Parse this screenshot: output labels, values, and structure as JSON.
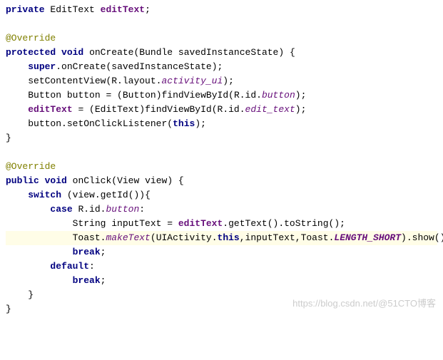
{
  "code": {
    "l1_private": "private",
    "l1_type": "EditText",
    "l1_var": "editText",
    "l3_anno": "@Override",
    "l4_protected": "protected",
    "l4_void": "void",
    "l4_fn": "onCreate",
    "l4_ptype": "Bundle",
    "l4_pname": "savedInstanceState",
    "l5_super": "super",
    "l5_call": "onCreate",
    "l5_arg": "savedInstanceState",
    "l6_call": "setContentView",
    "l6_r": "R.layout.",
    "l6_res": "activity_ui",
    "l7_type": "Button",
    "l7_name": "button",
    "l7_cast": "Button",
    "l7_call": "findViewById",
    "l7_r": "R.id.",
    "l7_res": "button",
    "l8_var": "editText",
    "l8_cast": "EditText",
    "l8_call": "findViewById",
    "l8_r": "R.id.",
    "l8_res": "edit_text",
    "l9_obj": "button",
    "l9_call": "setOnClickListener",
    "l9_this": "this",
    "l12_anno": "@Override",
    "l13_public": "public",
    "l13_void": "void",
    "l13_fn": "onClick",
    "l13_ptype": "View",
    "l13_pname": "view",
    "l14_switch": "switch",
    "l14_expr1": "view",
    "l14_expr2": "getId",
    "l15_case": "case",
    "l15_r": "R.id.",
    "l15_res": "button",
    "l16_type": "String",
    "l16_name": "inputText",
    "l16_var": "editText",
    "l16_c1": "getText",
    "l16_c2": "toString",
    "l17_cls": "Toast",
    "l17_mk": "makeText",
    "l17_act": "UIActivity",
    "l17_this": "this",
    "l17_arg": "inputText",
    "l17_cls2": "Toast",
    "l17_const": "LENGTH_SHORT",
    "l17_show": "show",
    "l18_break": "break",
    "l19_default": "default",
    "l20_break": "break"
  },
  "watermark": "https://blog.csdn.net/@51CTO博客"
}
